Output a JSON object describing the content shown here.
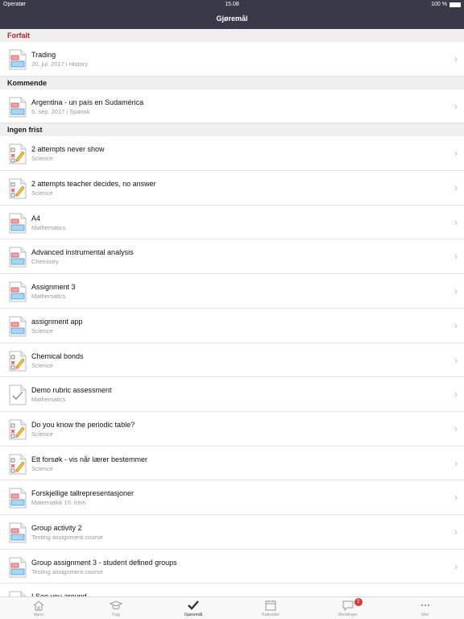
{
  "status_bar": {
    "carrier": "Operatør",
    "time": "15.08",
    "battery": "100 %"
  },
  "nav": {
    "title": "Gjøremål"
  },
  "sections": {
    "overdue": {
      "header": "Forfalt",
      "items": [
        {
          "title": "Trading",
          "subtitle": "20. jul. 2017 i History",
          "icon": "document-icon"
        }
      ]
    },
    "upcoming": {
      "header": "Kommende",
      "items": [
        {
          "title": "Argentina - un país en Sudamérica",
          "subtitle": "5. sep. 2017 i Spansk",
          "icon": "document-icon"
        }
      ]
    },
    "no_deadline": {
      "header": "Ingen frist",
      "items": [
        {
          "title": "2 attempts never show",
          "subtitle": "Science",
          "icon": "quiz-icon"
        },
        {
          "title": "2 attempts teacher decides, no answer",
          "subtitle": "Science",
          "icon": "quiz-icon"
        },
        {
          "title": "A4",
          "subtitle": "Mathematics",
          "icon": "document-icon"
        },
        {
          "title": "Advanced instrumental analysis",
          "subtitle": "Chemistry",
          "icon": "document-icon"
        },
        {
          "title": "Assignment 3",
          "subtitle": "Mathematics",
          "icon": "document-icon"
        },
        {
          "title": "assignment app",
          "subtitle": "Science",
          "icon": "document-icon"
        },
        {
          "title": "Chemical bonds",
          "subtitle": "Science",
          "icon": "quiz-icon"
        },
        {
          "title": "Demo rubric assessment",
          "subtitle": "Mathematics",
          "icon": "checkmark-document-icon"
        },
        {
          "title": "Do you know the periodic table?",
          "subtitle": "Science",
          "icon": "quiz-icon"
        },
        {
          "title": "Ett forsøk - vis når lærer bestemmer",
          "subtitle": "Science",
          "icon": "quiz-icon"
        },
        {
          "title": "Forskjellige tallrepresentasjoner",
          "subtitle": "Matematikk 10. trinn",
          "icon": "document-icon"
        },
        {
          "title": "Group activity 2",
          "subtitle": "Testing assignment course",
          "icon": "document-icon"
        },
        {
          "title": "Group assignment 3 - student defined groups",
          "subtitle": "Testing assignment course",
          "icon": "document-icon"
        },
        {
          "title": "I See you around",
          "subtitle": "",
          "icon": "document-icon"
        }
      ]
    }
  },
  "tabs": [
    {
      "label": "Hjem",
      "icon": "house-icon",
      "active": false
    },
    {
      "label": "Fag",
      "icon": "graduation-cap-icon",
      "active": false
    },
    {
      "label": "Gjøremål",
      "icon": "checkmark-icon",
      "active": true
    },
    {
      "label": "Kalender",
      "icon": "calendar-icon",
      "active": false
    },
    {
      "label": "Meldinger",
      "icon": "chat-bubble-icon",
      "active": false,
      "badge": "3"
    },
    {
      "label": "Mer",
      "icon": "more-dots-icon",
      "active": false
    }
  ],
  "colors": {
    "nav_background": "#3a3947",
    "overdue_header": "#b02b2b",
    "badge": "#d93a3a"
  }
}
